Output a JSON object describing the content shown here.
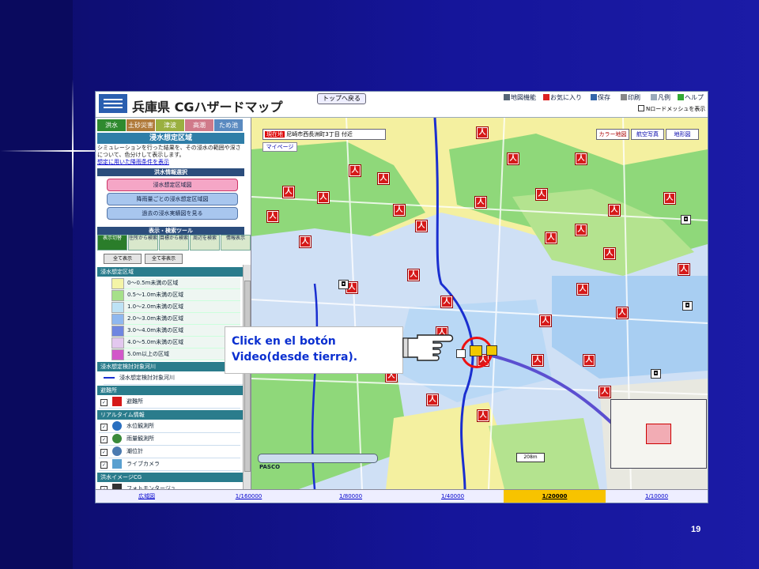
{
  "app": {
    "title": "兵庫県 CGハザードマップ",
    "top_button": "トップへ戻る"
  },
  "header_menu": [
    {
      "label": "地図機能",
      "icon": "list-icon"
    },
    {
      "label": "お気に入り",
      "icon": "flag-icon"
    },
    {
      "label": "保存",
      "icon": "save-icon"
    },
    {
      "label": "印刷",
      "icon": "print-icon"
    },
    {
      "label": "凡例",
      "icon": "legend-icon"
    },
    {
      "label": "ヘルプ",
      "icon": "help-icon"
    }
  ],
  "mesh_checkbox": "Nロードメッシュを表示",
  "sidebar": {
    "tabs": [
      "洪水",
      "土砂災害",
      "津波",
      "高潮",
      "ため池"
    ],
    "section_title": "浸水想定区域",
    "description": "シミュレーションを行った結果を、その浸水の範囲や深さについて、色分けして表示します。",
    "description_link": "想定に用いた降雨条件を表示",
    "flood_info_title": "洪水情報選択",
    "info_buttons": [
      "浸水想定区域図",
      "降雨量ごとの浸水想定区域図",
      "過去の浸水実績図を見る"
    ],
    "tools_title": "表示・検索ツール",
    "tool_columns": [
      "表示切替",
      "住所から検索",
      "目標から検索",
      "周辺を検索",
      "情報表示"
    ],
    "show_all": "全て表示",
    "hide_all": "全て非表示",
    "groups": {
      "flood_zone": "浸水想定区域",
      "legend": [
        {
          "label": "0〜0.5m未満の区域",
          "color": "#f4f4a6"
        },
        {
          "label": "0.5〜1.0m未満の区域",
          "color": "#a6e08a"
        },
        {
          "label": "1.0〜2.0m未満の区域",
          "color": "#bde2f5"
        },
        {
          "label": "2.0〜3.0m未満の区域",
          "color": "#8fb8ef"
        },
        {
          "label": "3.0〜4.0m未満の区域",
          "color": "#6f86e0"
        },
        {
          "label": "4.0〜5.0m未満の区域",
          "color": "#e3c8ef"
        },
        {
          "label": "5.0m以上の区域",
          "color": "#d257c9"
        }
      ],
      "river_group": "浸水想定検討対象河川",
      "river_item": "浸水想定検討対象河川",
      "shelter_group": "避難所",
      "shelter_item": "避難所",
      "realtime_group": "リアルタイム情報",
      "realtime_items": [
        "水位観測所",
        "雨量観測所",
        "潮位計",
        "ライブカメラ"
      ],
      "image_group": "洪水イメージCG",
      "image_items": [
        "フォトモンタージュ"
      ]
    }
  },
  "map": {
    "address_label": "現在地",
    "address": "尼崎市西長洲町3丁目 付近",
    "my_page": "マイページ",
    "map_tabs": [
      "カラー地図",
      "航空写真",
      "地形図"
    ],
    "attribution": "PASCO",
    "scale_text": "208m",
    "scales": [
      {
        "label": "広域図",
        "selected": false
      },
      {
        "label": "1/160000",
        "selected": false
      },
      {
        "label": "1/80000",
        "selected": false
      },
      {
        "label": "1/40000",
        "selected": false
      },
      {
        "label": "1/20000",
        "selected": true
      },
      {
        "label": "1/10000",
        "selected": false
      }
    ]
  },
  "callout": {
    "line1": "Click en el botón",
    "line2": "Video(desde tierra)."
  },
  "page_number": "19"
}
